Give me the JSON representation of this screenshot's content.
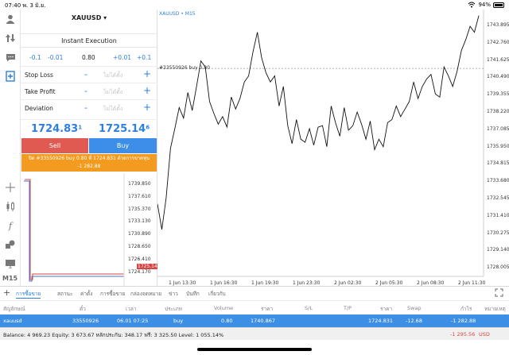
{
  "status": {
    "time": "07:40",
    "date": "พ. 3 มิ.ย.",
    "battery": "94%"
  },
  "toolbar": {
    "timeframe": "M15"
  },
  "order": {
    "symbol": "XAUUSD",
    "execution": "Instant Execution",
    "vol_minus_big": "-0.1",
    "vol_minus_small": "-0.01",
    "volume": "0.80",
    "vol_plus_small": "+0.01",
    "vol_plus_big": "+0.1",
    "stop_loss_label": "Stop Loss",
    "take_profit_label": "Take Profit",
    "deviation_label": "Deviation",
    "unset_value": "ไม่ได้ตั้ง",
    "minus_sign": "-",
    "plus_sign": "+",
    "bid_main": "1724.83",
    "bid_sup": "1",
    "ask_main": "1725.14",
    "ask_sup": "6",
    "sell_label": "Sell",
    "buy_label": "Buy",
    "notice_line1": "ปิด #33550926 buy 0.80 ที่ 1724.831 ด้วยการขาดทุน",
    "notice_line2": "-1 282.88"
  },
  "mini_chart": {
    "ticks": [
      "1739.850",
      "1737.610",
      "1735.370",
      "1733.130",
      "1730.890",
      "1728.650",
      "1726.410",
      "1724.170"
    ],
    "price_tag": "1725.146"
  },
  "chart": {
    "title": "XAUUSD • M15",
    "order_line_label": "#33550926 buy 0.80",
    "y_ticks": [
      "1743.895",
      "1742.760",
      "1741.625",
      "1740.490",
      "1739.355",
      "1738.220",
      "1737.085",
      "1735.950",
      "1734.815",
      "1733.680",
      "1732.545",
      "1731.410",
      "1730.275",
      "1729.140",
      "1728.005"
    ],
    "x_ticks": [
      "1 Jun 13:30",
      "1 Jun 16:30",
      "1 Jun 19:30",
      "1 Jun 23:30",
      "2 Jun 02:30",
      "2 Jun 05:30",
      "2 Jun 08:30",
      "2 Jun 11:30"
    ]
  },
  "chart_data": {
    "type": "line",
    "title": "XAUUSD • M15",
    "ylim": [
      1727.2,
      1744.5
    ],
    "order_line": 1740.8,
    "values": [
      1731.8,
      1730.1,
      1732.2,
      1735.5,
      1736.8,
      1738.2,
      1737.5,
      1739.2,
      1738.0,
      1739.6,
      1741.3,
      1740.9,
      1738.6,
      1737.8,
      1737.1,
      1737.6,
      1736.9,
      1738.9,
      1738.1,
      1738.8,
      1739.9,
      1740.3,
      1741.9,
      1743.2,
      1741.5,
      1740.5,
      1739.9,
      1740.3,
      1738.3,
      1739.6,
      1737.0,
      1735.8,
      1737.4,
      1736.1,
      1735.9,
      1736.8,
      1735.7,
      1736.9,
      1737.0,
      1735.6,
      1738.3,
      1737.2,
      1736.3,
      1738.2,
      1736.7,
      1737.0,
      1737.9,
      1737.1,
      1736.1,
      1737.3,
      1735.4,
      1736.1,
      1735.6,
      1737.2,
      1737.4,
      1738.3,
      1737.6,
      1738.1,
      1738.6,
      1739.9,
      1738.8,
      1739.6,
      1740.1,
      1740.4,
      1739.1,
      1738.9,
      1740.9,
      1740.3,
      1739.6,
      1740.6,
      1742.0,
      1742.7,
      1743.6,
      1743.2,
      1744.3
    ]
  },
  "terminal": {
    "tabs": [
      "การซื้อขาย",
      "สถานะ",
      "ค่าตั้ง",
      "การซื้อขาย",
      "กล่องจดหมาย",
      "ข่าว",
      "บันทึก",
      "เกี่ยวกับ"
    ],
    "columns": [
      "สัญลักษณ์",
      "ตั๋ว",
      "เวลา",
      "ประเภท",
      "Volume",
      "ราคา",
      "S/L",
      "T/P",
      "ราคา",
      "Swap",
      "กำไร",
      "หมายเหตุ"
    ],
    "row": {
      "symbol": "xauusd",
      "ticket": "33550926",
      "time": "06.01 07:25",
      "type": "buy",
      "volume": "0.80",
      "open_price": "1740.867",
      "price": "1724.831",
      "swap": "-12.68",
      "profit": "-1 282.88"
    },
    "balance_text": "Balance: 4 969.23 Equity: 3 673.67 หลักประกัน: 348.17 ฟรี: 3 325.50 Level: 1 055.14%",
    "balance_profit": "-1 295.56",
    "balance_currency": "USD"
  },
  "colors": {
    "accent": "#2d7fe0",
    "sell": "#e05a52",
    "buy": "#3c8ee6",
    "notice": "#f29b1e",
    "selected_row": "#3d8fe6",
    "loss": "#d64541"
  }
}
